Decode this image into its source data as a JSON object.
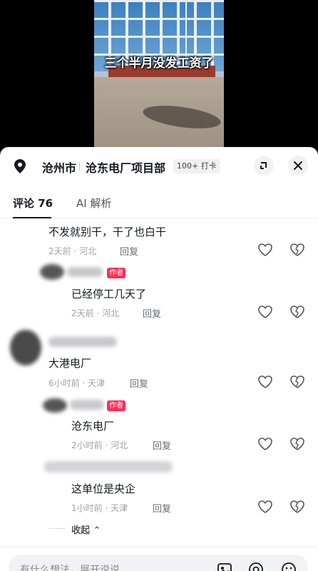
{
  "video": {
    "caption": "三个半月没发工资了"
  },
  "location": {
    "city": "沧州市",
    "place": "沧东电厂项目部",
    "checkin": "100+ 打卡"
  },
  "tabs": {
    "comments": "评论 76",
    "ai": "AI 解析"
  },
  "comments": [
    {
      "text": "不发就别干，干了也白干",
      "meta": "2天前 · 河北",
      "reply": "回复"
    },
    {
      "author_badge": "作者",
      "text": "已经停工几天了",
      "meta": "2天前 · 河北",
      "reply": "回复"
    },
    {
      "text": "大港电厂",
      "meta": "6小时前 · 天津",
      "reply": "回复"
    },
    {
      "author_badge": "作者",
      "text": "沧东电厂",
      "meta": "2小时前 · 河北",
      "reply": "回复"
    },
    {
      "text": "这单位是央企",
      "meta": "1小时前 · 天津",
      "reply": "回复"
    }
  ],
  "collapse": "收起",
  "input": {
    "placeholder": "有什么想法，展开说说"
  },
  "colors": {
    "author_badge": "#fe2c55",
    "text_primary": "#161823",
    "text_secondary": "#a0a2a8"
  }
}
